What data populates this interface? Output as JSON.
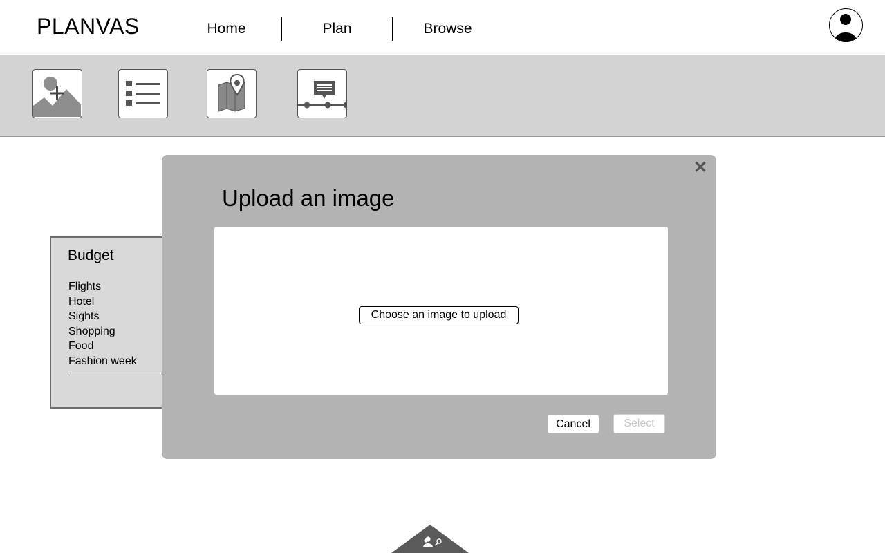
{
  "header": {
    "logo": "PLANVAS",
    "nav": [
      {
        "label": "Home"
      },
      {
        "label": "Plan"
      },
      {
        "label": "Browse"
      }
    ],
    "avatar_icon": "user-avatar-icon"
  },
  "toolbar": {
    "tools": [
      {
        "icon": "add-image-icon"
      },
      {
        "icon": "list-icon"
      },
      {
        "icon": "map-pin-icon"
      },
      {
        "icon": "timeline-comment-icon"
      }
    ]
  },
  "budget": {
    "title": "Budget",
    "items": [
      "Flights",
      "Hotel",
      "Sights",
      "Shopping",
      "Food",
      "Fashion week"
    ]
  },
  "modal": {
    "title": "Upload an image",
    "choose_label": "Choose an image to upload",
    "cancel_label": "Cancel",
    "select_label": "Select",
    "close_icon": "close-icon"
  },
  "bottom_tab": {
    "icon": "collaborators-search-icon"
  },
  "colors": {
    "toolbar_bg": "#d3d3d3",
    "modal_bg": "#b3b3b3",
    "card_bg": "#d9d9d9",
    "disabled_text": "#c8c8c8",
    "icon_gray": "#6e6e6e"
  }
}
